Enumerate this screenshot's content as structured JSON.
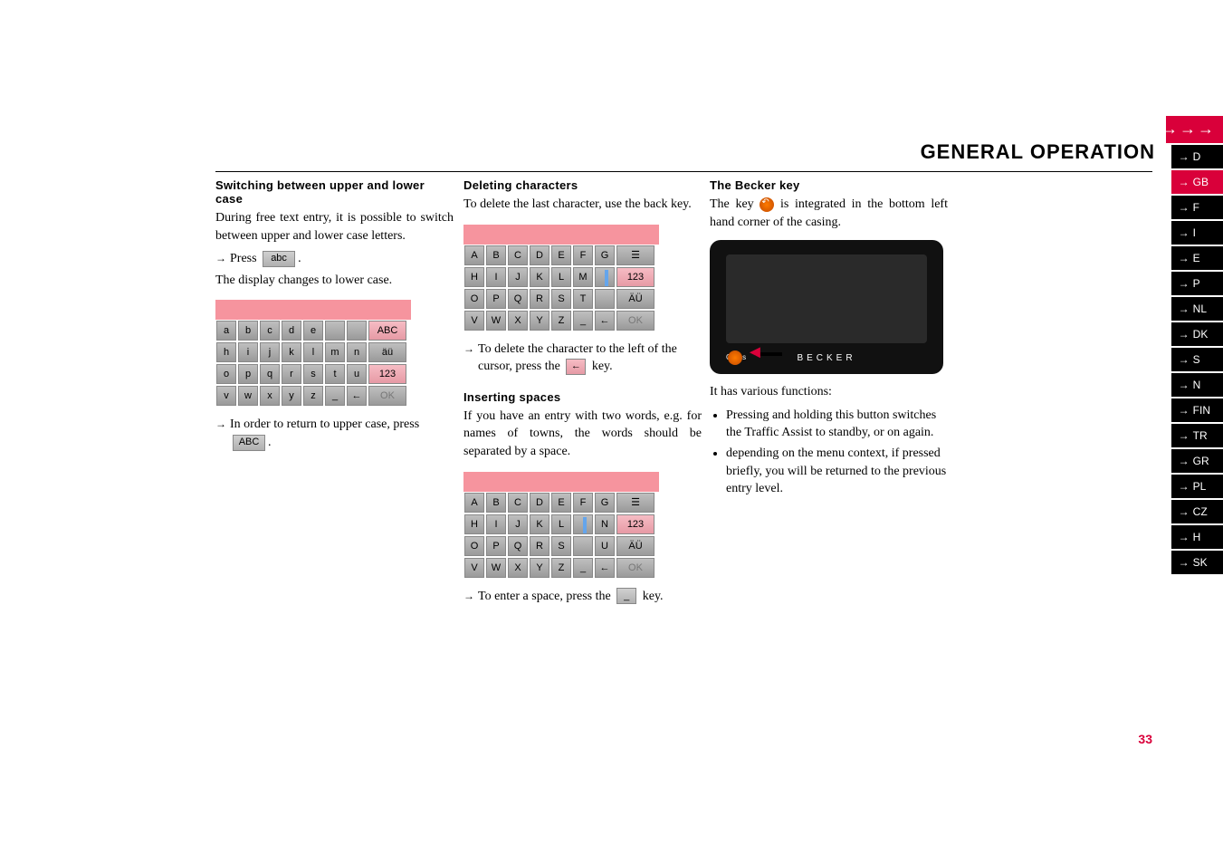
{
  "header": "GENERAL OPERATION",
  "arrows": "→→→",
  "pagenum": "33",
  "sidebar": [
    "D",
    "GB",
    "F",
    "I",
    "E",
    "P",
    "NL",
    "DK",
    "S",
    "N",
    "FIN",
    "TR",
    "GR",
    "PL",
    "CZ",
    "H",
    "SK"
  ],
  "sidebar_arrow": "→",
  "sidebar_accent_index": 1,
  "col1": {
    "h1": "Switching between upper and lower case",
    "p1": "During free text entry, it is possible to switch between upper and lower case letters.",
    "press_prefix": "Press",
    "press_key": "abc",
    "press_suffix": ".",
    "p2": "The display changes to lower case.",
    "kb_rows": [
      [
        "a",
        "b",
        "c",
        "d",
        "e",
        "",
        "",
        "ABC"
      ],
      [
        "h",
        "i",
        "j",
        "k",
        "l",
        "m",
        "n",
        "äü"
      ],
      [
        "o",
        "p",
        "q",
        "r",
        "s",
        "t",
        "u",
        "123"
      ],
      [
        "v",
        "w",
        "x",
        "y",
        "z",
        "_",
        "←",
        "OK"
      ]
    ],
    "kb_highlight_row1_last": "ABC",
    "kb_highlight_row3_last": "123",
    "return_text": "In order to return to upper case, press",
    "return_key": "ABC",
    "return_suffix": "."
  },
  "col2": {
    "h1": "Deleting characters",
    "p1": "To delete the last character, use the back key.",
    "kb1_rows": [
      [
        "A",
        "B",
        "C",
        "D",
        "E",
        "F",
        "G",
        "☰"
      ],
      [
        "H",
        "I",
        "J",
        "K",
        "L",
        "M",
        "",
        "123"
      ],
      [
        "O",
        "P",
        "Q",
        "R",
        "S",
        "T",
        "",
        "ÄÜ"
      ],
      [
        "V",
        "W",
        "X",
        "Y",
        "Z",
        "_",
        "←",
        "OK"
      ]
    ],
    "del_text": "To delete the character to the left of the cursor, press the",
    "del_key": "←",
    "del_suffix": " key.",
    "h2": "Inserting spaces",
    "p2": "If you have an entry with two words, e.g. for names of towns, the words should be separated by a space.",
    "kb2_rows": [
      [
        "A",
        "B",
        "C",
        "D",
        "E",
        "F",
        "G",
        "☰"
      ],
      [
        "H",
        "I",
        "J",
        "K",
        "L",
        "",
        "N",
        "123"
      ],
      [
        "O",
        "P",
        "Q",
        "R",
        "S",
        "",
        "U",
        "ÄÜ"
      ],
      [
        "V",
        "W",
        "X",
        "Y",
        "Z",
        "_",
        "←",
        "OK"
      ]
    ],
    "space_text": "To enter a space, press the",
    "space_key": "_",
    "space_suffix": " key."
  },
  "col3": {
    "h1": "The Becker key",
    "p1_pre": "The key ",
    "p1_post": " is integrated in the bottom left hand corner of the casing.",
    "device_small_label": "Güns",
    "device_brand": "BECKER",
    "p2": "It has various functions:",
    "bullets": [
      "Pressing and holding this button switches the Traffic Assist to standby, or on again.",
      "depending on the menu context, if pressed briefly, you will be returned to the previous entry level."
    ]
  }
}
